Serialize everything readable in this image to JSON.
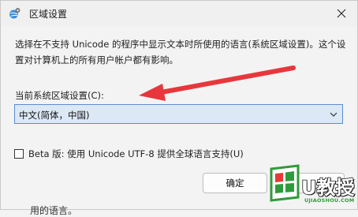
{
  "window": {
    "title": "区域设置",
    "icon": "globe-gear-icon",
    "close_icon": "close-icon"
  },
  "description": "选择在不支持 Unicode 的程序中显示文本时所使用的语言(系统区域设置)。这个设置对计算机上的所有用户帐户都有影响。",
  "current_locale": {
    "label": "当前系统区域设置(C):",
    "value": "中文(简体，中国)"
  },
  "beta_option": {
    "label": "Beta 版: 使用 Unicode UTF-8 提供全球语言支持(U)",
    "checked": false
  },
  "buttons": {
    "ok": "确定",
    "cancel": ""
  },
  "background_text": "用的语言。",
  "annotation": {
    "type": "arrow",
    "color": "#e8373c"
  },
  "watermark": {
    "brand": "U教授",
    "url": "UJIAOSHOU.COM",
    "logo": "windows-logo-icon",
    "colors": {
      "green": "#2e9b3a",
      "red": "#e53935"
    }
  }
}
